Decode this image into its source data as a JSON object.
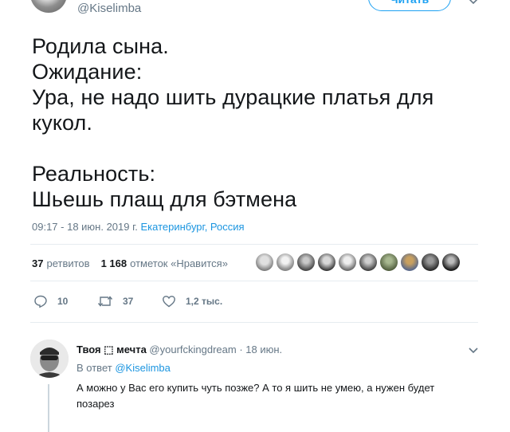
{
  "author": {
    "handle": "@Kiselimba",
    "follow_label": "Читать"
  },
  "tweet": {
    "text": "Родила сына.\nОжидание:\nУра, не надо шить дурацкие платья для кукол.\n\nРеальность:\nШьешь плащ для бэтмена",
    "time": "09:17 - 18 июн. 2019 г.",
    "location": "Екатеринбург, Россия"
  },
  "stats": {
    "retweets_count": "37",
    "retweets_label": "ретвитов",
    "likes_count": "1 168",
    "likes_label": "отметок «Нравится»"
  },
  "actions": {
    "replies": "10",
    "retweets": "37",
    "likes": "1,2 тыс."
  },
  "reply": {
    "name": "Твоя ⬚ мечта",
    "handle": "@yourfckingdream",
    "time": "· 18 июн.",
    "reply_to_label": "В ответ",
    "reply_to_handle": "@Kiselimba",
    "text": "А можно у Вас его купить чуть позже? А то я шить не умею, а нужен будет позарез"
  },
  "colors": {
    "accent": "#1da1f2",
    "link": "#1b95e0",
    "secondary_text": "#657786",
    "primary_text": "#14171a",
    "divider": "#e6ecf0"
  }
}
